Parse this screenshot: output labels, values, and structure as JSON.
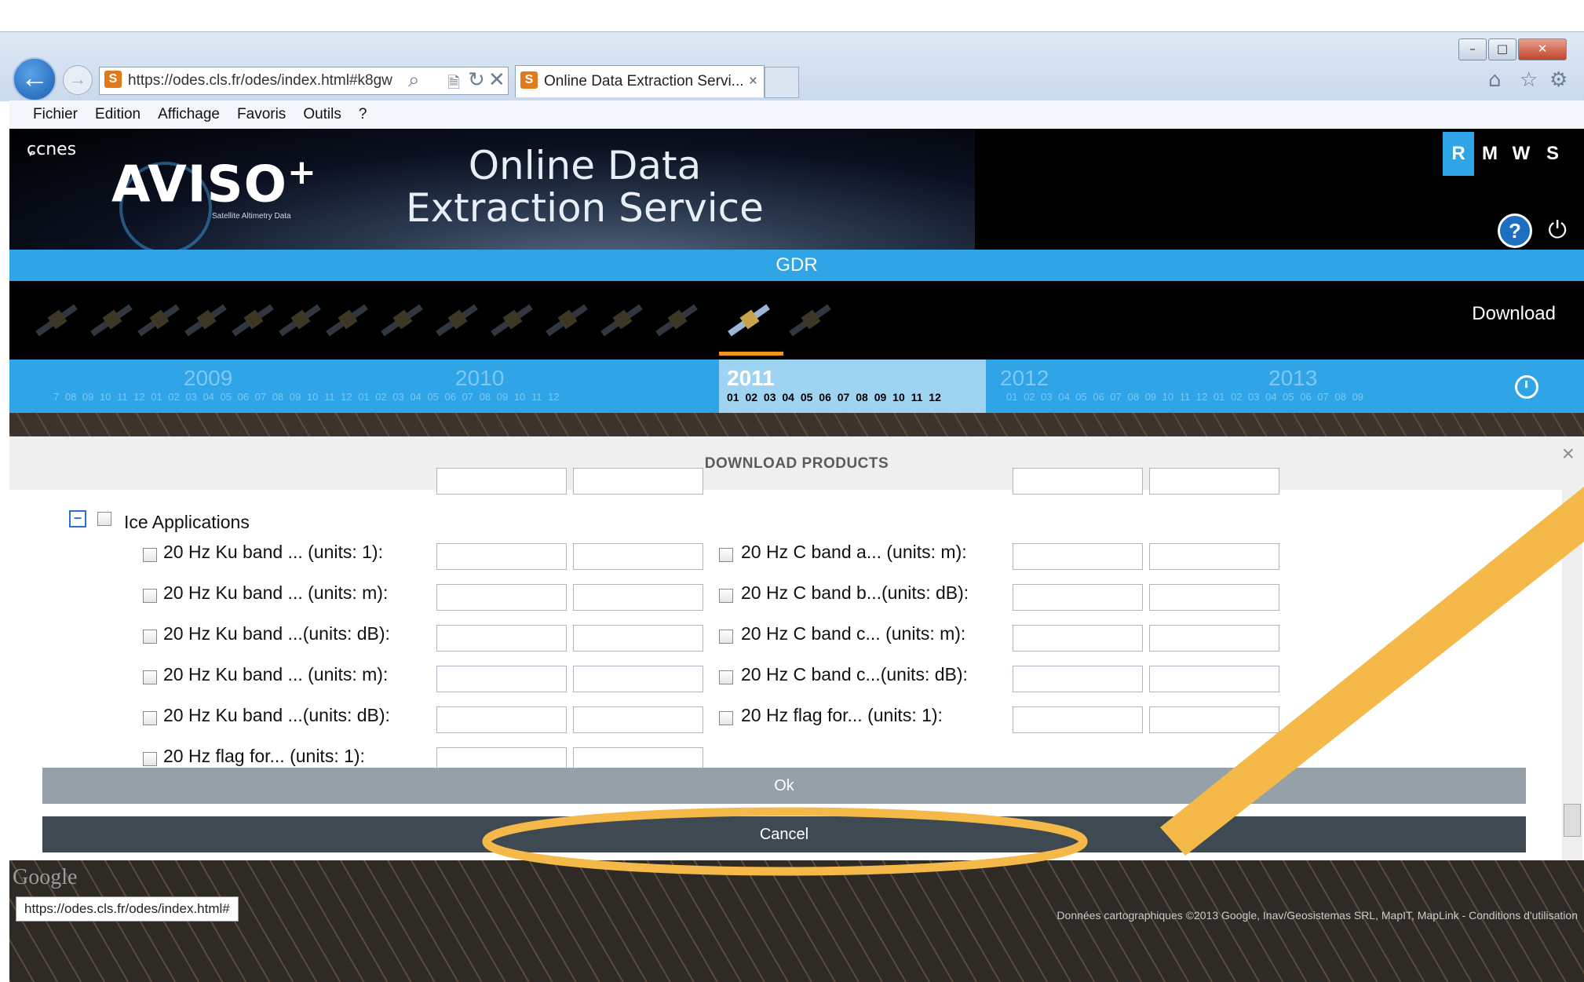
{
  "browser": {
    "address": "https://odes.cls.fr/odes/index.html#k8gw",
    "tab_title": "Online Data Extraction Servi...",
    "tab_close": "×",
    "menu": [
      "Fichier",
      "Edition",
      "Affichage",
      "Favoris",
      "Outils",
      "?"
    ],
    "status_url": "https://odes.cls.fr/odes/index.html#"
  },
  "header": {
    "cnes": "cnes",
    "aviso": "AVISO",
    "aviso_plus": "+",
    "aviso_sub": "Satellite Altimetry Data",
    "service_line1": "Online Data",
    "service_line2": "Extraction Service",
    "modes": [
      "R",
      "M",
      "W",
      "S"
    ],
    "active_mode": "R",
    "help": "?"
  },
  "product_bar": {
    "label": "GDR"
  },
  "nav": {
    "download": "Download"
  },
  "timeline": {
    "years": [
      "2009",
      "2010",
      "2011",
      "2012",
      "2013"
    ],
    "active_year": "2011",
    "months_active": "01 02 03 04 05 06 07 08 09 10 11 12",
    "months_left": "7 08 09 10 11 12 01 02 03 04 05 06 07 08 09 10 11 12 01 02 03 04 05 06 07 08 09 10 11 12",
    "months_right": "01 02 03 04 05 06 07 08 09 10 11 12 01 02 03 04 05 06 07 08 09"
  },
  "modal": {
    "title": "DOWNLOAD PRODUCTS",
    "close": "×",
    "section": "Ice Applications",
    "left_fields": [
      "20 Hz Ku band ... (units: 1):",
      "20 Hz Ku band ... (units: m):",
      "20 Hz Ku band ...(units: dB):",
      "20 Hz Ku band ... (units: m):",
      "20 Hz Ku band ...(units: dB):",
      "20 Hz flag for... (units: 1):"
    ],
    "right_fields": [
      "20 Hz C band a... (units: m):",
      "20 Hz C band b...(units: dB):",
      "20 Hz C band c... (units: m):",
      "20 Hz C band c...(units: dB):",
      "20 Hz flag for... (units: 1):"
    ],
    "ok": "Ok",
    "cancel": "Cancel"
  },
  "map": {
    "google": "Google",
    "attribution": "Données cartographiques ©2013 Google, Inav/Geosistemas SRL, MapIT, MapLink -  Conditions d'utilisation"
  },
  "colors": {
    "accent": "#2fa4e7",
    "highlight": "#f5b94a",
    "ok_button": "#96a0a9",
    "cancel_button": "#3f4952"
  }
}
